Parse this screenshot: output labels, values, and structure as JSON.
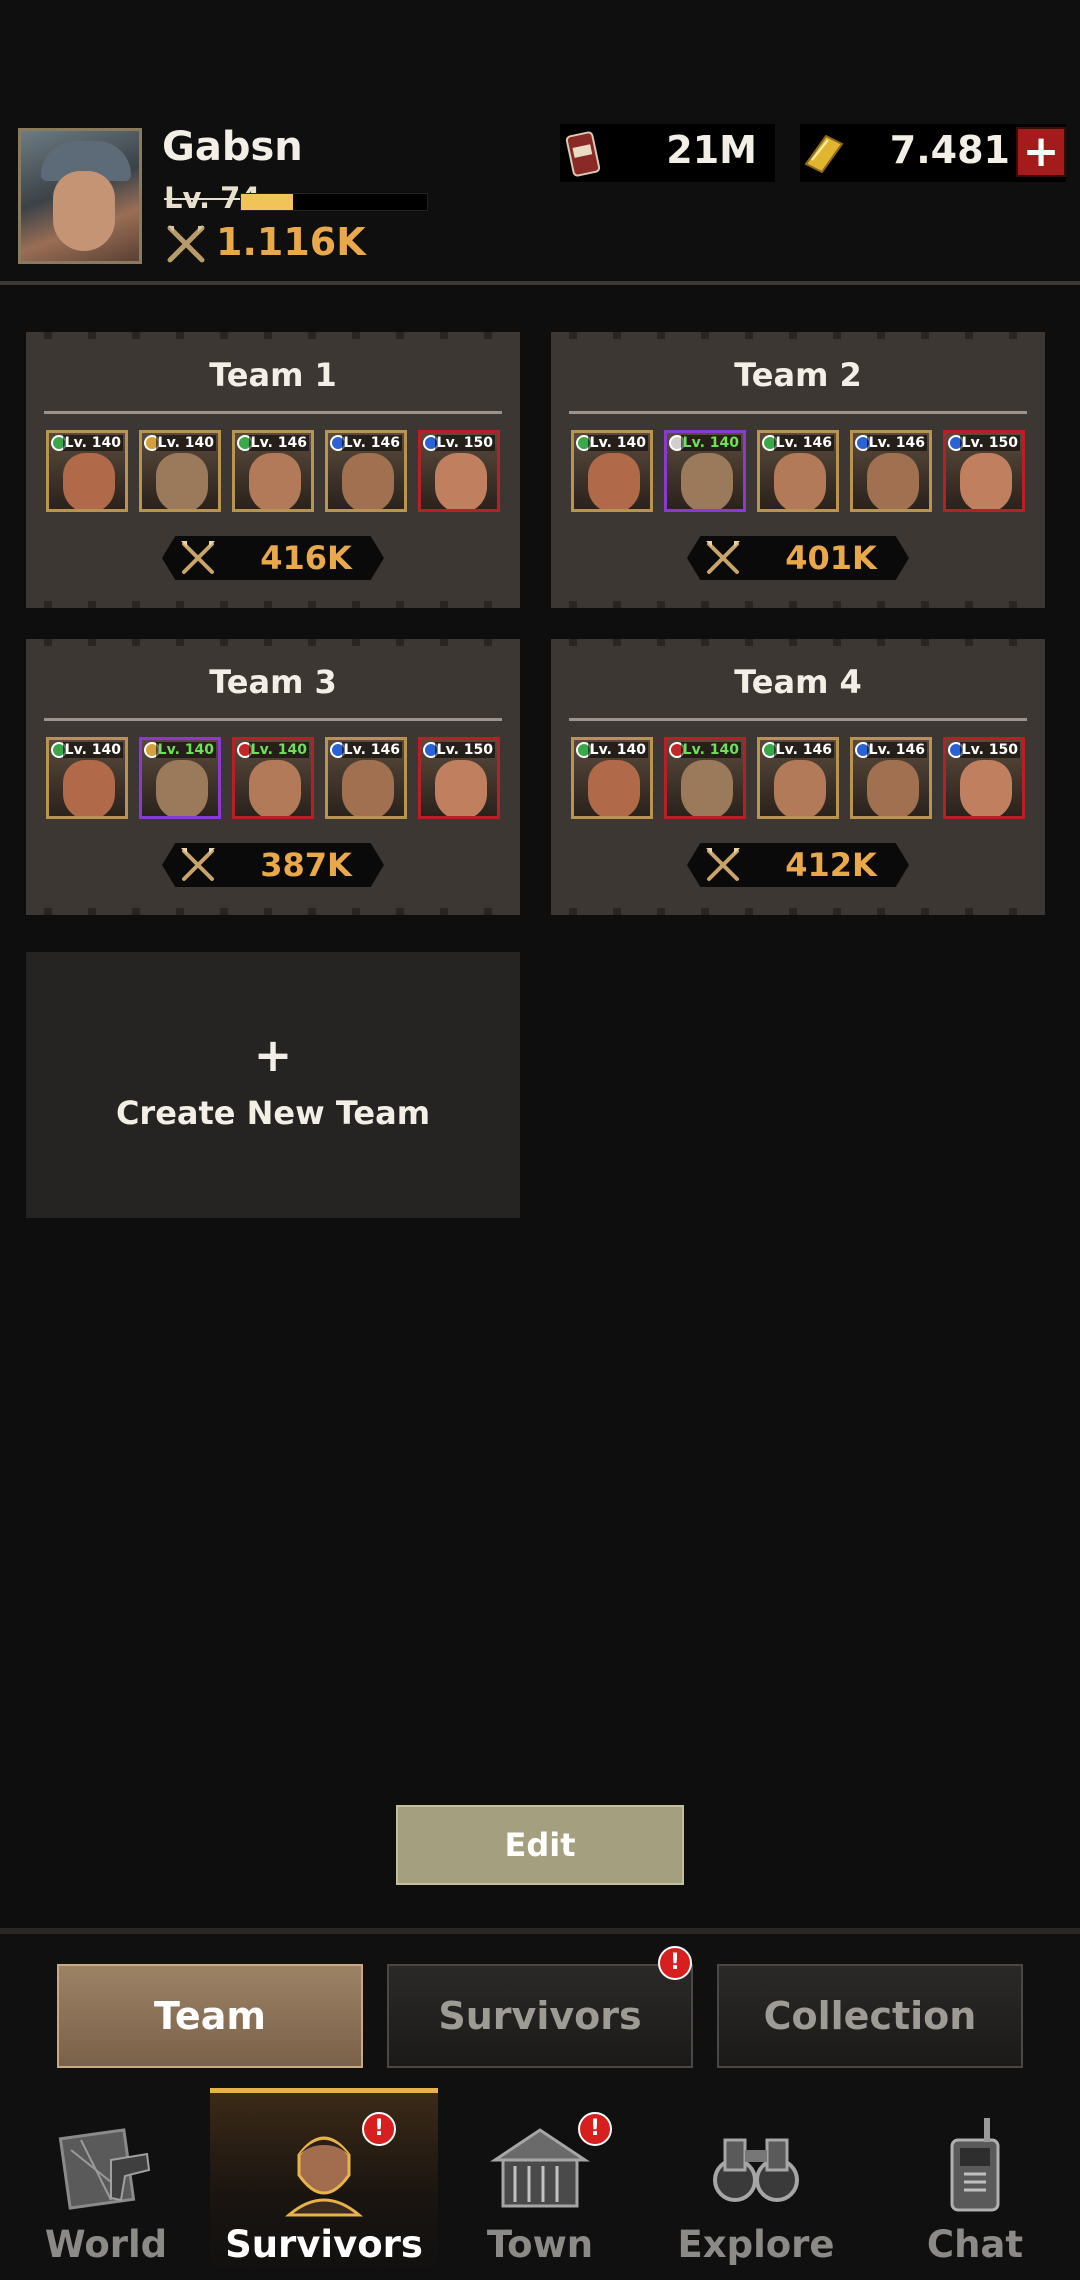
{
  "player": {
    "name": "Gabsn",
    "level": "Lv. 74",
    "xp_progress": 0.28,
    "power": "1.116K"
  },
  "resources": {
    "cash": "21M",
    "gold": "7.481",
    "add_label": "+"
  },
  "teams": [
    {
      "title": "Team 1",
      "power": "416K",
      "heroes": [
        {
          "level": "Lv. 140",
          "frame": "gold",
          "class_color": "#3aa84a",
          "level_color": "white"
        },
        {
          "level": "Lv. 140",
          "frame": "gold",
          "class_color": "#d6a03a",
          "level_color": "white"
        },
        {
          "level": "Lv. 146",
          "frame": "gold",
          "class_color": "#3aa84a",
          "level_color": "white"
        },
        {
          "level": "Lv. 146",
          "frame": "gold",
          "class_color": "#2a62d6",
          "level_color": "white"
        },
        {
          "level": "Lv. 150",
          "frame": "red",
          "class_color": "#2a62d6",
          "level_color": "white"
        }
      ]
    },
    {
      "title": "Team 2",
      "power": "401K",
      "heroes": [
        {
          "level": "Lv. 140",
          "frame": "gold",
          "class_color": "#3aa84a",
          "level_color": "white"
        },
        {
          "level": "Lv. 140",
          "frame": "purple",
          "class_color": "#cfcfcf",
          "level_color": "green"
        },
        {
          "level": "Lv. 146",
          "frame": "gold",
          "class_color": "#3aa84a",
          "level_color": "white"
        },
        {
          "level": "Lv. 146",
          "frame": "gold",
          "class_color": "#2a62d6",
          "level_color": "white"
        },
        {
          "level": "Lv. 150",
          "frame": "red",
          "class_color": "#2a62d6",
          "level_color": "white"
        }
      ]
    },
    {
      "title": "Team 3",
      "power": "387K",
      "heroes": [
        {
          "level": "Lv. 140",
          "frame": "gold",
          "class_color": "#3aa84a",
          "level_color": "white"
        },
        {
          "level": "Lv. 140",
          "frame": "purple",
          "class_color": "#d6a03a",
          "level_color": "green"
        },
        {
          "level": "Lv. 140",
          "frame": "red",
          "class_color": "#c0292c",
          "level_color": "green"
        },
        {
          "level": "Lv. 146",
          "frame": "gold",
          "class_color": "#2a62d6",
          "level_color": "white"
        },
        {
          "level": "Lv. 150",
          "frame": "red",
          "class_color": "#2a62d6",
          "level_color": "white"
        }
      ]
    },
    {
      "title": "Team 4",
      "power": "412K",
      "heroes": [
        {
          "level": "Lv. 140",
          "frame": "gold",
          "class_color": "#3aa84a",
          "level_color": "white"
        },
        {
          "level": "Lv. 140",
          "frame": "red",
          "class_color": "#c0292c",
          "level_color": "green"
        },
        {
          "level": "Lv. 146",
          "frame": "gold",
          "class_color": "#3aa84a",
          "level_color": "white"
        },
        {
          "level": "Lv. 146",
          "frame": "gold",
          "class_color": "#2a62d6",
          "level_color": "white"
        },
        {
          "level": "Lv. 150",
          "frame": "red",
          "class_color": "#2a62d6",
          "level_color": "white"
        }
      ]
    }
  ],
  "create_team": {
    "plus": "+",
    "label": "Create New Team"
  },
  "edit_label": "Edit",
  "segments": {
    "team": "Team",
    "survivors": "Survivors",
    "collection": "Collection",
    "active": "team"
  },
  "alert_mark": "!",
  "nav": {
    "world": "World",
    "survivors": "Survivors",
    "town": "Town",
    "explore": "Explore",
    "chat": "Chat",
    "active": "survivors"
  },
  "colors": {
    "accent_gold": "#e9a94a",
    "card_bg": "#3d3733",
    "alert_red": "#d81f1f"
  }
}
